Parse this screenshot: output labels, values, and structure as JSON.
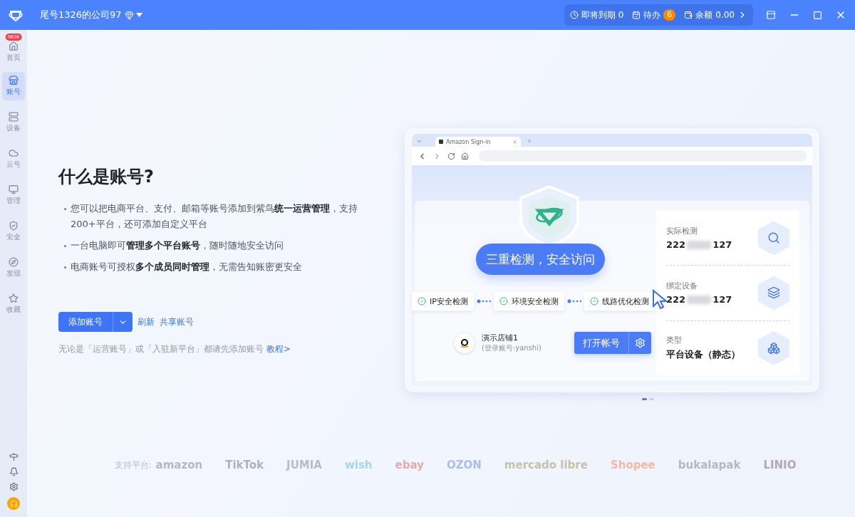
{
  "titlebar": {
    "company": "尾号1326的公司97",
    "status": [
      {
        "kind": "expire",
        "label": "即将到期",
        "value": "0"
      },
      {
        "kind": "todo",
        "label": "待办",
        "badge": "6"
      },
      {
        "kind": "balance",
        "label": "余额",
        "value": "0.00"
      }
    ]
  },
  "sidebar": {
    "items": [
      {
        "label": "首页",
        "badge": "NEW",
        "selected": false
      },
      {
        "label": "账号",
        "selected": true
      },
      {
        "label": "设备",
        "selected": false
      },
      {
        "label": "云号",
        "selected": false
      },
      {
        "label": "管理",
        "selected": false
      },
      {
        "label": "安全",
        "selected": false
      },
      {
        "label": "发现",
        "selected": false
      },
      {
        "label": "收藏",
        "selected": false
      }
    ]
  },
  "intro": {
    "title": "什么是账号?",
    "bullets": [
      "您可以把电商平台、支付、邮箱等账号添加到紫鸟**统一运营管理**，支持200+平台，还可添加自定义平台",
      "一台电脑即可**管理多个平台账号**，随时随地安全访问",
      "电商账号可授权**多个成员同时管理**，无需告知账密更安全"
    ],
    "primary_button": "添加账号",
    "links": [
      "刷新",
      "共享账号"
    ],
    "note": "无论是「运营账号」或「入驻新平台」都请先添加账号",
    "note_link": "教程>"
  },
  "illustration": {
    "tab": "Amazon Sign-in",
    "banner": "三重检测，安全访问",
    "checks": [
      "IP安全检测",
      "环境安全检测",
      "线路优化检测"
    ],
    "store": {
      "name": "演示店铺1",
      "login": "(登录账号:yanshi)",
      "button": "打开帐号"
    },
    "info": [
      {
        "label": "实际检测",
        "value_start": "222",
        "value_end": "127"
      },
      {
        "label": "绑定设备",
        "value_start": "222",
        "value_end": "127"
      },
      {
        "label": "类型",
        "value": "平台设备（静态）"
      }
    ]
  },
  "carousel": [
    {
      "selected": true
    },
    {
      "selected": false
    }
  ],
  "platforms": {
    "label": "支持平台:",
    "logos": [
      {
        "name": "amazon",
        "color": "#b4b8c2"
      },
      {
        "name": "TikTok",
        "color": "#aeb2ba"
      },
      {
        "name": "JUMIA",
        "color": "#b8bcc4"
      },
      {
        "name": "wish",
        "color": "#9fd8ef"
      },
      {
        "name": "ebay",
        "color": "#e9a9b0"
      },
      {
        "name": "OZON",
        "color": "#a9bff2"
      },
      {
        "name": "mercado libre",
        "color": "#c6c2a8"
      },
      {
        "name": "Shopee",
        "color": "#f4b8a8"
      },
      {
        "name": "bukalapak",
        "color": "#b6b9c2"
      },
      {
        "name": "LINIO",
        "color": "#b3a9ae"
      }
    ]
  }
}
